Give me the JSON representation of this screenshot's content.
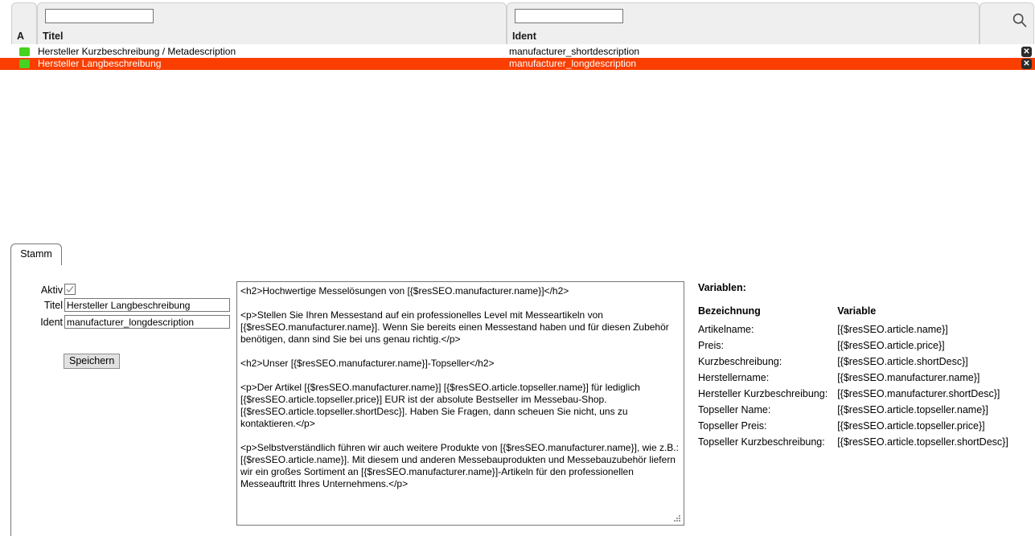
{
  "grid": {
    "columns": [
      {
        "key": "status",
        "label": "A"
      },
      {
        "key": "title",
        "label": "Titel"
      },
      {
        "key": "ident",
        "label": "Ident"
      }
    ],
    "filters": {
      "title_value": "",
      "title_placeholder": "",
      "ident_value": "",
      "ident_placeholder": ""
    },
    "search_icon": "search-icon",
    "delete_icon_label": "✕",
    "rows": [
      {
        "status": "active",
        "title": "Hersteller Kurzbeschreibung / Metadescription",
        "ident": "manufacturer_shortdescription",
        "selected": false
      },
      {
        "status": "active",
        "title": "Hersteller Langbeschreibung",
        "ident": "manufacturer_longdescription",
        "selected": true
      }
    ],
    "colors": {
      "selected_row_bg": "#f93e00",
      "selected_row_text": "#ffffff",
      "status_active": "#45d220",
      "delete_button_bg": "#2b2b2b",
      "header_panel_bg": "#efefef"
    }
  },
  "tabs": {
    "items": [
      {
        "label": "Stamm",
        "active": true
      }
    ]
  },
  "form": {
    "aktiv_label": "Aktiv",
    "aktiv_checked": true,
    "titel_label": "Titel",
    "titel_value": "Hersteller Langbeschreibung",
    "ident_label": "Ident",
    "ident_value": "manufacturer_longdescription",
    "save_label": "Speichern"
  },
  "editor": {
    "content": "<h2>Hochwertige Messelösungen von [{$resSEO.manufacturer.name}]</h2>\n\n<p>Stellen Sie Ihren Messestand auf ein professionelles Level mit Messeartikeln von [{$resSEO.manufacturer.name}]. Wenn Sie bereits einen Messestand haben und für diesen Zubehör benötigen, dann sind Sie bei uns genau richtig.</p>\n\n<h2>Unser [{$resSEO.manufacturer.name}]-Topseller</h2>\n\n<p>Der Artikel [{$resSEO.manufacturer.name}] [{$resSEO.article.topseller.name}] für lediglich [{$resSEO.article.topseller.price}] EUR ist der absolute Bestseller im Messebau-Shop. [{$resSEO.article.topseller.shortDesc}]. Haben Sie Fragen, dann scheuen Sie nicht, uns zu kontaktieren.</p>\n\n<p>Selbstverständlich führen wir auch weitere Produkte von [{$resSEO.manufacturer.name}], wie z.B.: [{$resSEO.article.name}]. Mit diesem und anderen Messebauprodukten und Messebauzubehör liefern wir ein großes Sortiment an [{$resSEO.manufacturer.name}]-Artikeln für den professionellen Messeauftritt Ihres Unternehmens.</p>"
  },
  "variables": {
    "title": "Variablen:",
    "header_name": "Bezeichnung",
    "header_variable": "Variable",
    "rows": [
      {
        "name": "Artikelname:",
        "variable": "[{$resSEO.article.name}]"
      },
      {
        "name": "Preis:",
        "variable": "[{$resSEO.article.price}]"
      },
      {
        "name": "Kurzbeschreibung:",
        "variable": "[{$resSEO.article.shortDesc}]"
      },
      {
        "name": "Herstellername:",
        "variable": "[{$resSEO.manufacturer.name}]"
      },
      {
        "name": "Hersteller Kurzbeschreibung:",
        "variable": "[{$resSEO.manufacturer.shortDesc}]"
      },
      {
        "name": "Topseller Name:",
        "variable": "[{$resSEO.article.topseller.name}]"
      },
      {
        "name": "Topseller Preis:",
        "variable": "[{$resSEO.article.topseller.price}]"
      },
      {
        "name": "Topseller Kurzbeschreibung:",
        "variable": "[{$resSEO.article.topseller.shortDesc}]"
      }
    ]
  }
}
